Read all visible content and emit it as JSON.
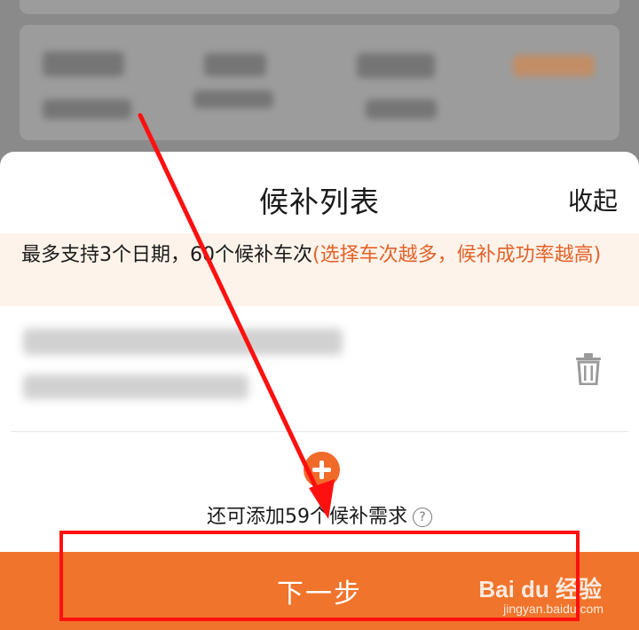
{
  "sheet": {
    "title": "候补列表",
    "collapse_label": "收起"
  },
  "notice": {
    "main_text": "最多支持3个日期，60个候补车次",
    "highlight_text": "(选择车次越多，候补成功率越高)"
  },
  "trash_icon": "trash-icon",
  "add": {
    "icon": "plus-circle-icon",
    "remaining_text": "还可添加59个候补需求",
    "help_icon": "question-circle-icon",
    "help_glyph": "?"
  },
  "footer": {
    "next_label": "下一步"
  },
  "watermark": {
    "brand": "Bai du 经验",
    "url": "jingyan.baidu.com"
  },
  "colors": {
    "accent": "#f0742b",
    "notice_bg": "#fdf3ea",
    "notice_highlight": "#e2622a",
    "annotation": "#ff1010"
  }
}
